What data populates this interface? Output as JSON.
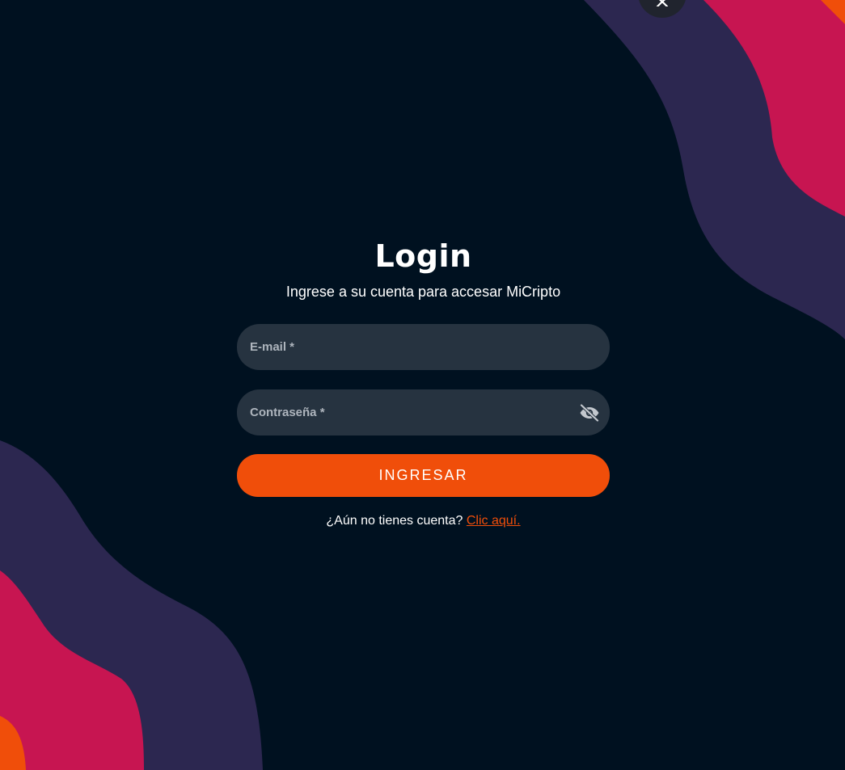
{
  "login": {
    "title": "Login",
    "subtitle": "Ingrese a su cuenta para accesar MiCripto",
    "email_label": "E-mail *",
    "password_label": "Contraseña *",
    "submit_label": "INGRESAR",
    "signup_prompt": "¿Aún no tienes cuenta?",
    "signup_link": "Clic aquí."
  },
  "icons": {
    "close": "close-icon",
    "password_visibility": "eye-off-icon"
  },
  "colors": {
    "background": "#001120",
    "wave_purple": "#2c2750",
    "wave_magenta": "#c71551",
    "wave_orange": "#f04e0a",
    "field_background": "#263340",
    "accent": "#f04e0a"
  }
}
